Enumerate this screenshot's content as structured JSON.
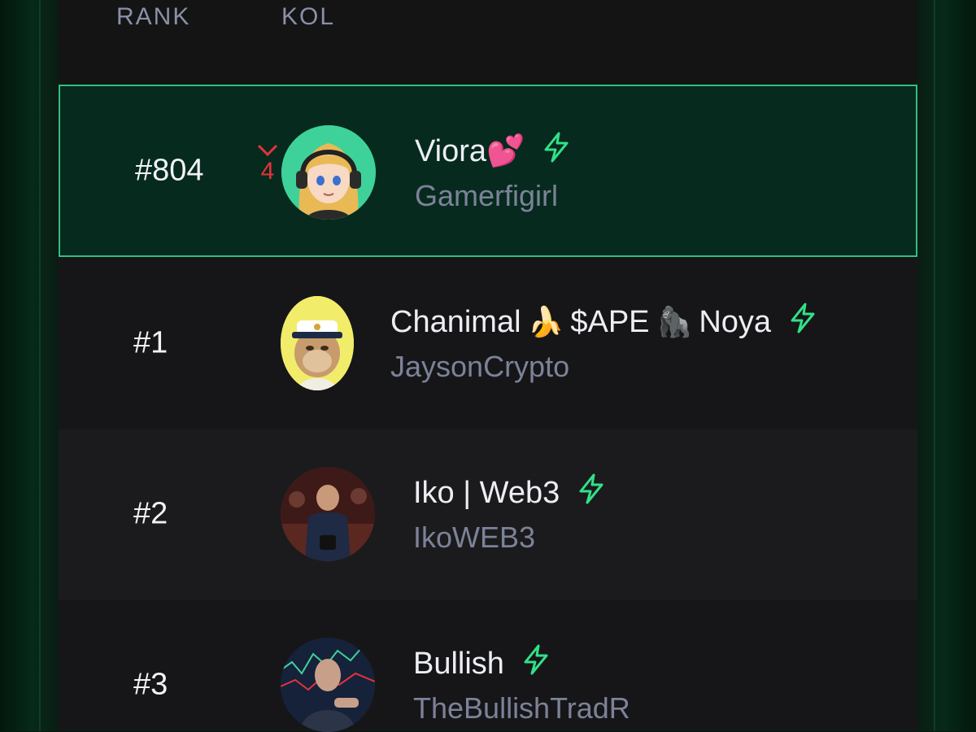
{
  "header": {
    "rank_label": "RANK",
    "kol_label": "KOL"
  },
  "rows": [
    {
      "rank": "#804",
      "change": "4",
      "name": "Viora💕",
      "handle": "Gamerfigirl"
    },
    {
      "rank": "#1",
      "name_part1": "Chanimal",
      "emoji1": "🍌",
      "name_part2": "$APE",
      "emoji2": "🦍",
      "name_part3": "Noya",
      "handle": "JaysonCrypto"
    },
    {
      "rank": "#2",
      "name": "Iko | Web3",
      "handle": "IkoWEB3"
    },
    {
      "rank": "#3",
      "name": "Bullish",
      "handle": "TheBullishTradR"
    }
  ],
  "colors": {
    "accent": "#2fbf7e",
    "down": "#e8323a",
    "verified": "#33e08a"
  },
  "icons": {
    "verified": "lightning-bolt-icon",
    "down": "chevron-down-icon"
  }
}
